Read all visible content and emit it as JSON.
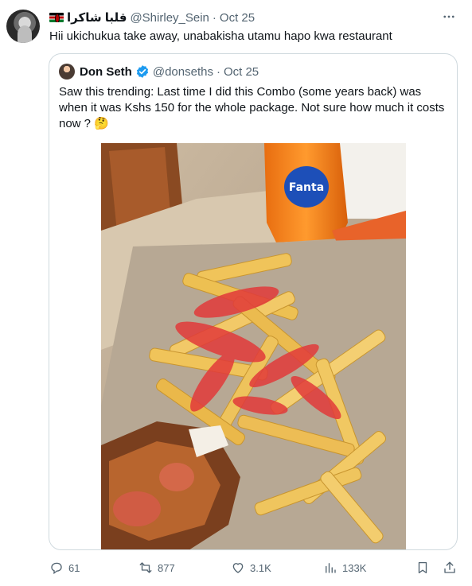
{
  "tweet": {
    "author_name": "قلبا شاكرا",
    "author_handle": "@Shirley_Sein",
    "separator": "·",
    "date": "Oct 25",
    "text": "Hii ukichukua take away, unabakisha utamu hapo kwa restaurant"
  },
  "quoted": {
    "author_name": "Don Seth",
    "author_handle": "@donseths",
    "separator": "·",
    "date": "Oct 25",
    "text": "Saw this trending: Last time I did this Combo (some years back) was when it was Kshs 150 for the whole package. Not sure how much it costs now ? 🤔",
    "photo_logo_text": "Fanta"
  },
  "actions": {
    "replies": "61",
    "reposts": "877",
    "likes": "3.1K",
    "views": "133K"
  },
  "icons": [
    "more-icon",
    "verified-icon",
    "reply-icon",
    "repost-icon",
    "like-icon",
    "views-icon",
    "bookmark-icon",
    "share-icon"
  ],
  "colors": {
    "verified": "#1d9bf0",
    "secondary_text": "#536471",
    "border": "#cfd9de"
  }
}
